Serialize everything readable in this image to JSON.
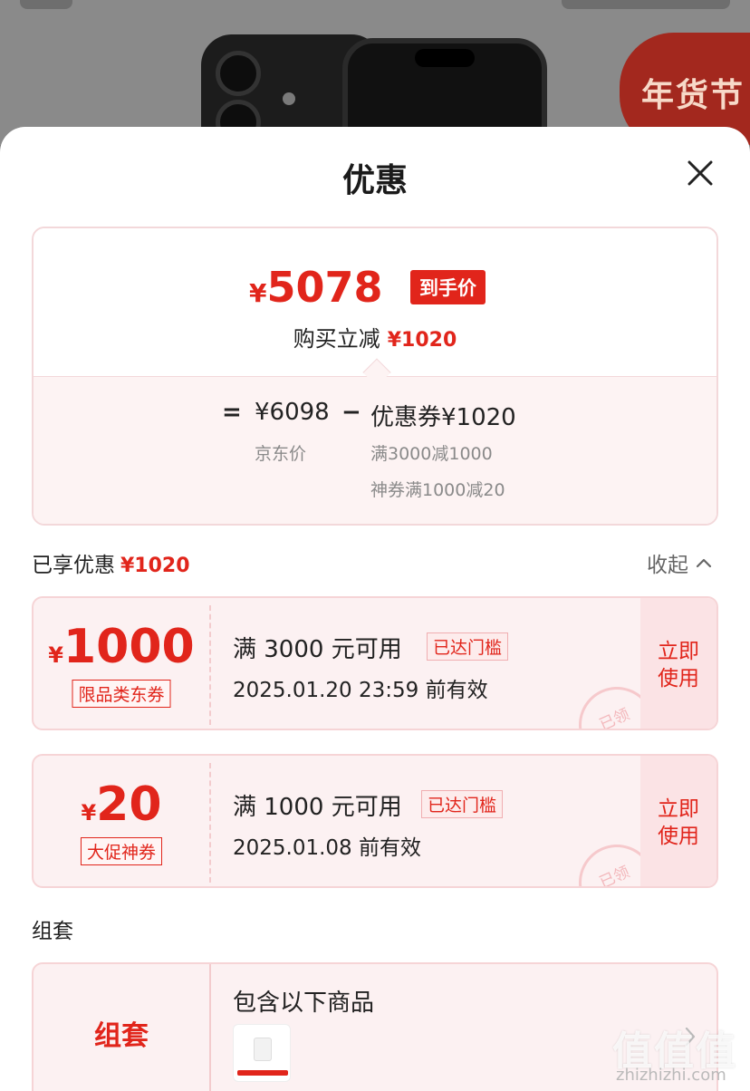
{
  "background": {
    "festival_badge": "年货节"
  },
  "sheet": {
    "title": "优惠",
    "close_icon": "close-icon"
  },
  "price_card": {
    "final_currency": "¥",
    "final_price": "5078",
    "final_tag": "到手价",
    "instant_cut_label": "购买立减",
    "instant_cut_amount": "¥1020",
    "equals": "=",
    "jd_price": "¥6098",
    "jd_price_label": "京东价",
    "minus": "−",
    "coupon_total": "优惠券¥1020",
    "coupon_detail_1": "满3000减1000",
    "coupon_detail_2": "神券满1000减20"
  },
  "enjoyed": {
    "label": "已享优惠",
    "amount": "¥1020",
    "collapse_label": "收起"
  },
  "coupons": [
    {
      "currency": "¥",
      "value": "1000",
      "kind": "限品类东券",
      "condition": "满 3000 元可用",
      "reached": "已达门槛",
      "expiry": "2025.01.20 23:59 前有效",
      "use_label": "立即使用",
      "stamp": "已领"
    },
    {
      "currency": "¥",
      "value": "20",
      "kind": "大促神券",
      "condition": "满 1000 元可用",
      "reached": "已达门槛",
      "expiry": "2025.01.08 前有效",
      "use_label": "立即使用",
      "stamp": "已领"
    }
  ],
  "bundle": {
    "section_label": "组套",
    "name": "组套",
    "title": "包含以下商品"
  },
  "watermark": {
    "logo": "值值值",
    "url": "zhizhizhi.com"
  },
  "colors": {
    "accent": "#e1251b",
    "card_border": "#f3d8da",
    "coupon_bg": "#fcf1f2"
  }
}
